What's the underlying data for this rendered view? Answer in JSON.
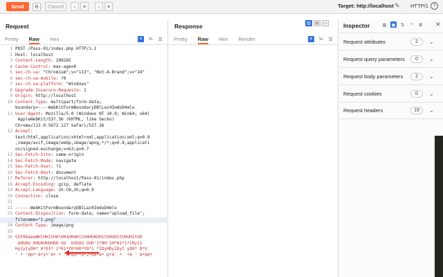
{
  "toolbar": {
    "send_label": "Send",
    "cancel_label": "Cancel",
    "target_text": "Target: http://localhost",
    "http_version": "HTTP/1",
    "help": "?"
  },
  "request": {
    "title": "Request",
    "tabs": [
      "Pretty",
      "Raw",
      "Hex"
    ],
    "active_tab": "Raw",
    "tab_icons": [
      "wrap",
      "\\n",
      "menu"
    ]
  },
  "response": {
    "title": "Response",
    "tabs": [
      "Pretty",
      "Raw",
      "Hex",
      "Render"
    ],
    "active_tab": "Raw",
    "tab_icons": [
      "wrap",
      "\\n",
      "menu"
    ]
  },
  "inspector": {
    "title": "Inspector",
    "rows": [
      {
        "label": "Request attributes",
        "count": "2"
      },
      {
        "label": "Request query parameters",
        "count": "0"
      },
      {
        "label": "Request body parameters",
        "count": "2"
      },
      {
        "label": "Request cookies",
        "count": "0"
      },
      {
        "label": "Request headers",
        "count": "19"
      }
    ]
  },
  "colors": {
    "accent": "#ff6633",
    "selected": "#2f72d6",
    "header_key": "#c03030"
  },
  "code_lines": [
    {
      "n": "1",
      "k": "",
      "v": "POST /Pass-01/index.php HTTP/1.1"
    },
    {
      "n": "2",
      "k": "",
      "v": "Host: localhost"
    },
    {
      "n": "3",
      "k": "Content-Length",
      "v": ": 299285"
    },
    {
      "n": "4",
      "k": "Cache-Control",
      "v": ": max-age=0"
    },
    {
      "n": "5",
      "k": "sec-ch-ua",
      "v": ": \"Chromium\";v=\"113\", \"Not-A.Brand\";v=\"24\""
    },
    {
      "n": "6",
      "k": "sec-ch-ua-mobile",
      "v": ": ?0"
    },
    {
      "n": "7",
      "k": "sec-ch-ua-platform",
      "v": ": \"Windows\""
    },
    {
      "n": "8",
      "k": "Upgrade-Insecure-Requests",
      "v": ": 1"
    },
    {
      "n": "9",
      "k": "Origin",
      "v": ": http://localhost"
    },
    {
      "n": "10",
      "k": "Content-Type",
      "v": ": multipart/form-data;"
    },
    {
      "n": "",
      "k": "",
      "v": "boundary=----WebKitFormBoundaryDBlLaz4ImdoD4mlo"
    },
    {
      "n": "11",
      "k": "User-Agent",
      "v": ": Mozilla/5.0 (Windows NT 10.0; Win64; x64)"
    },
    {
      "n": "",
      "k": "",
      "v": " AppleWebKit/537.36 (KHTML, like Gecko)"
    },
    {
      "n": "",
      "k": "",
      "v": "Chrome/113.0.5672.127 Safari/537.36"
    },
    {
      "n": "12",
      "k": "Accept",
      "v": ":"
    },
    {
      "n": "",
      "k": "",
      "v": "text/html,application/xhtml+xml,application/xml;q=0.9"
    },
    {
      "n": "",
      "k": "",
      "v": ",image/avif,image/webp,image/apng,*/*;q=0.8,applicati"
    },
    {
      "n": "",
      "k": "",
      "v": "on/signed-exchange;v=b3;q=0.7"
    },
    {
      "n": "13",
      "k": "Sec-Fetch-Site",
      "v": ": same-origin"
    },
    {
      "n": "14",
      "k": "Sec-Fetch-Mode",
      "v": ": navigate"
    },
    {
      "n": "15",
      "k": "Sec-Fetch-User",
      "v": ": ?1"
    },
    {
      "n": "16",
      "k": "Sec-Fetch-Dest",
      "v": ": document"
    },
    {
      "n": "17",
      "k": "Referer",
      "v": ": http://localhost/Pass-01/index.php"
    },
    {
      "n": "18",
      "k": "Accept-Encoding",
      "v": ": gzip, deflate"
    },
    {
      "n": "19",
      "k": "Accept-Language",
      "v": ": zh-CN,zh;q=0.9"
    },
    {
      "n": "20",
      "k": "Connection",
      "v": ": close"
    },
    {
      "n": "21",
      "k": "",
      "v": ""
    },
    {
      "n": "22",
      "k": "",
      "v": "------WebKitFormBoundaryDBlLaz4ImdoD4mlo"
    },
    {
      "n": "23",
      "k": "Content-Disposition",
      "v": ": form-data; name=\"upload_file\";"
    },
    {
      "n": "",
      "k": "",
      "v": "filename=\"1.png\""
    },
    {
      "n": "24",
      "k": "Content-Type",
      "v": ": image/png"
    },
    {
      "n": "25",
      "k": "",
      "v": ""
    },
    {
      "n": "26",
      "k": "",
      "v": "GIF89aeoWHlHH1tHHlHH1HHUH1tUHHUHUH1tUHUH1tUHUH1tUH"
    },
    {
      "n": "",
      "k": "",
      "v": " UHUHU UHUHUHUHOO UU  UUUUU UUH'1*HH'1H*H1*1*[Hy[1"
    },
    {
      "n": "",
      "k": "",
      "v": "HyIyIyOH* H*OI* 1*01*YD*HO*YD*1 *IDyHDyIDyI yOO* D*U"
    },
    {
      "n": "",
      "k": "",
      "v": "' * '00*'0*1*'0* * '0*00**0*2*00*0* D*0' *  *0 ' 0*00*"
    }
  ]
}
